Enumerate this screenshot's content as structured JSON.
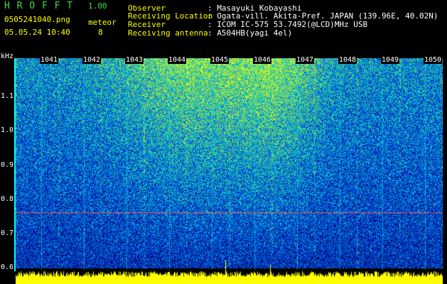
{
  "header": {
    "app_title": "H R O F F T",
    "version": "1.00",
    "filename": "0505241040.png",
    "mode_label": "meteor",
    "datetime": "05.05.24 10:40",
    "count": "8"
  },
  "info": {
    "observer_label": "Observer",
    "observer_value": ": Masayuki Kobayashi",
    "location_label": "Receiving Location",
    "location_value": ": Ogata-vill. Akita-Pref. JAPAN (139.96E, 40.02N)",
    "receiver_label": "Receiver",
    "receiver_value": ": ICOM IC-575 53.7492(@LCD)MHz USB",
    "antenna_label": "Receiving antenna",
    "antenna_value": ": A504HB(yagi 4el)"
  },
  "plot": {
    "y_unit": "kHz",
    "y_ticks": [
      "1.1",
      "1.0",
      "0.9",
      "0.8",
      "0.7",
      "0.6"
    ],
    "y_tick_values": [
      1.1,
      1.0,
      0.9,
      0.8,
      0.7,
      0.6
    ],
    "y_range": [
      0.58,
      1.2
    ],
    "time_labels": [
      "1041",
      "1042",
      "1043",
      "1044",
      "1045",
      "1046",
      "1047",
      "1048",
      "1049",
      "1050"
    ],
    "marker_freq_khz": 0.762,
    "colors": {
      "marker": "#ff6060",
      "level": "#ffff00",
      "axis": "#00ffff"
    }
  }
}
